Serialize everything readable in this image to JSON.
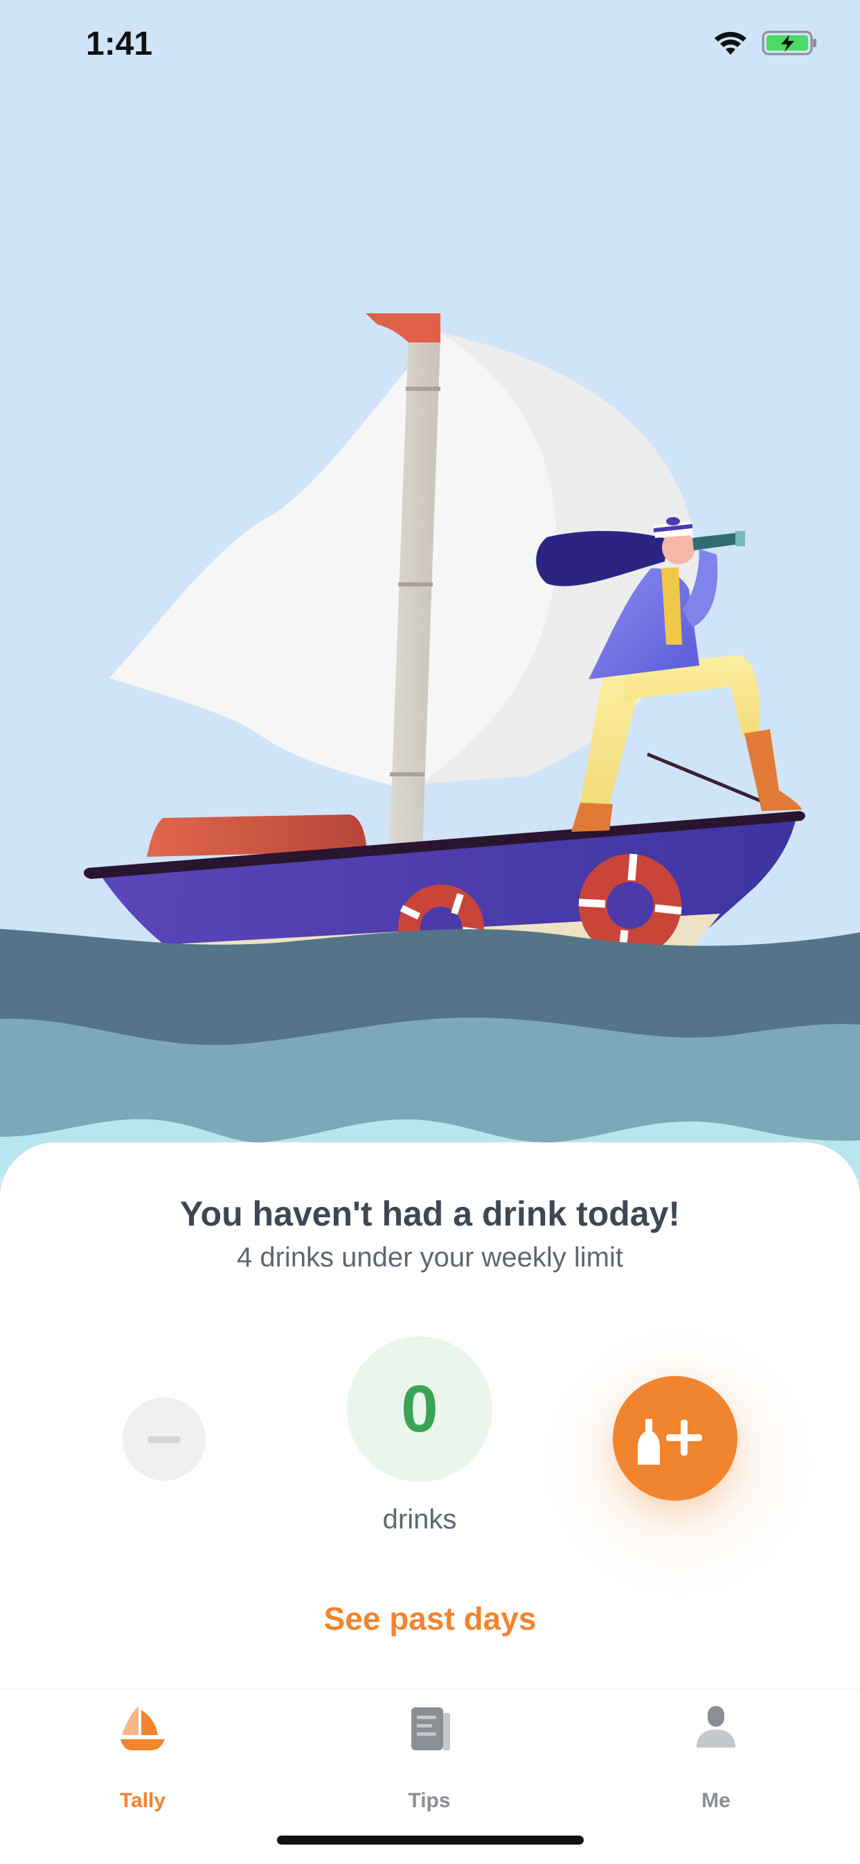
{
  "status_bar": {
    "time": "1:41"
  },
  "message": {
    "headline": "You haven't had a drink today!",
    "subline": "4 drinks under your weekly limit"
  },
  "counter": {
    "value": "0",
    "unit": "drinks"
  },
  "links": {
    "past_days": "See past days"
  },
  "tabs": [
    {
      "label": "Tally",
      "icon": "sailboat-icon",
      "active": true
    },
    {
      "label": "Tips",
      "icon": "document-icon",
      "active": false
    },
    {
      "label": "Me",
      "icon": "person-icon",
      "active": false
    }
  ],
  "colors": {
    "accent": "#f1842e",
    "count_green": "#3aa356",
    "sky": "#cfe4f8",
    "inactive_tab": "#8a8e95"
  }
}
